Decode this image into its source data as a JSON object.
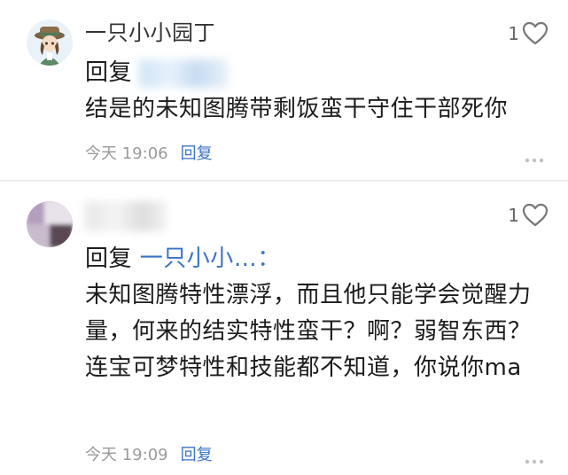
{
  "comments": [
    {
      "username": "一只小小园丁",
      "likes": "1",
      "reply_prefix": "回复",
      "text": "结是的未知图腾带剩饭蛮干守住干部死你",
      "time": "今天 19:06",
      "reply_button": "回复"
    },
    {
      "likes": "1",
      "reply_prefix": "回复",
      "reply_target": "一只小小…：",
      "text": "未知图腾特性漂浮，而且他只能学会觉醒力量，何来的结实特性蛮干？啊？弱智东西？连宝可梦特性和技能都不知道，你说你ma",
      "time": "今天 19:09",
      "reply_button": "回复"
    }
  ],
  "colors": {
    "accent_link": "#3a73c7",
    "meta_gray": "#9a9a9a",
    "divider": "#ededed"
  },
  "icons": {
    "like": "heart-outline-icon",
    "more": "more-dots-icon"
  }
}
